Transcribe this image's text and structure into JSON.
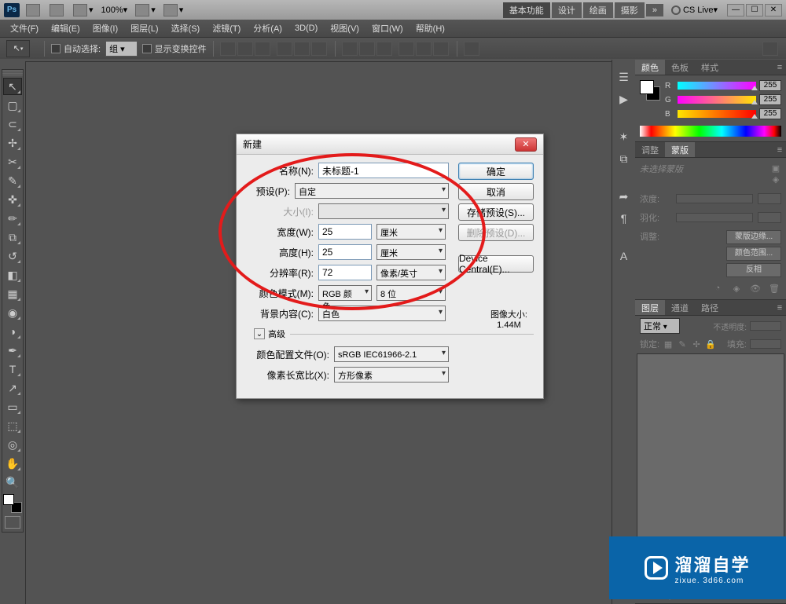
{
  "app_bar": {
    "zoom": "100%",
    "workspace_active": "基本功能",
    "workspaces": [
      "设计",
      "绘画",
      "摄影"
    ],
    "cs_live": "CS Live"
  },
  "menu": {
    "items": [
      "文件(F)",
      "编辑(E)",
      "图像(I)",
      "图层(L)",
      "选择(S)",
      "滤镜(T)",
      "分析(A)",
      "3D(D)",
      "视图(V)",
      "窗口(W)",
      "帮助(H)"
    ]
  },
  "options_bar": {
    "auto_select_label": "自动选择:",
    "auto_select_value": "组",
    "show_transform_label": "显示变换控件"
  },
  "color_panel": {
    "tabs": [
      "颜色",
      "色板",
      "样式"
    ],
    "r": "255",
    "g": "255",
    "b": "255"
  },
  "mask_panel": {
    "tabs": [
      "调整",
      "蒙版"
    ],
    "placeholder": "未选择蒙版",
    "density_label": "浓度:",
    "feather_label": "羽化:",
    "refine_label": "调整:",
    "btn_edge": "蒙版边缘...",
    "btn_range": "颜色范围...",
    "btn_invert": "反相"
  },
  "layers_panel": {
    "tabs": [
      "图层",
      "通道",
      "路径"
    ],
    "blend_mode": "正常",
    "opacity_label": "不透明度:",
    "lock_label": "锁定:",
    "fill_label": "填充:"
  },
  "dialog": {
    "title": "新建",
    "name_label": "名称(N):",
    "name_value": "未标题-1",
    "preset_label": "预设(P):",
    "preset_value": "自定",
    "size_label": "大小(I):",
    "width_label": "宽度(W):",
    "width_value": "25",
    "width_unit": "厘米",
    "height_label": "高度(H):",
    "height_value": "25",
    "height_unit": "厘米",
    "resolution_label": "分辨率(R):",
    "resolution_value": "72",
    "resolution_unit": "像素/英寸",
    "colormode_label": "颜色模式(M):",
    "colormode_value": "RGB 颜色",
    "bitdepth_value": "8 位",
    "bgcontent_label": "背景内容(C):",
    "bgcontent_value": "白色",
    "advanced_label": "高级",
    "profile_label": "颜色配置文件(O):",
    "profile_value": "sRGB IEC61966-2.1",
    "pixelaspect_label": "像素长宽比(X):",
    "pixelaspect_value": "方形像素",
    "btn_ok": "确定",
    "btn_cancel": "取消",
    "btn_save_preset": "存储预设(S)...",
    "btn_delete_preset": "删除预设(D)...",
    "btn_device_central": "Device Central(E)...",
    "imagesize_label": "图像大小:",
    "imagesize_value": "1.44M"
  },
  "watermark": {
    "main": "溜溜自学",
    "sub": "zixue. 3d66.com"
  }
}
